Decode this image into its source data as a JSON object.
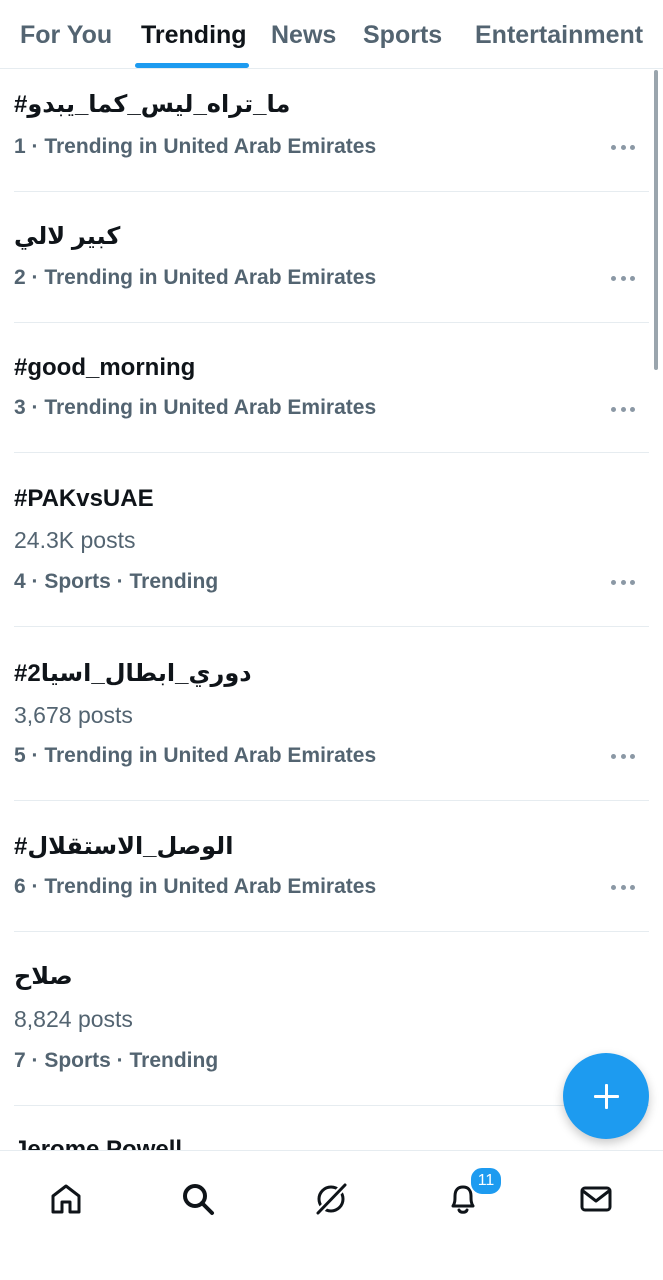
{
  "tabs": [
    "For You",
    "Trending",
    "News",
    "Sports",
    "Entertainment"
  ],
  "active_tab": "Trending",
  "trends": [
    {
      "title": "#ما_تراه_ليس_كما_يبدو",
      "posts": null,
      "meta": "1 · Trending in United Arab Emirates"
    },
    {
      "title": "كبير لالي",
      "posts": null,
      "meta": "2 · Trending in United Arab Emirates"
    },
    {
      "title": "#good_morning",
      "posts": null,
      "meta": "3 · Trending in United Arab Emirates"
    },
    {
      "title": "#PAKvsUAE",
      "posts": "24.3K posts",
      "meta": "4 · Sports · Trending"
    },
    {
      "title": "#دوري_ابطال_اسيا2",
      "posts": "3,678 posts",
      "meta": "5 · Trending in United Arab Emirates"
    },
    {
      "title": "#الوصل_الاستقلال",
      "posts": null,
      "meta": "6 · Trending in United Arab Emirates"
    },
    {
      "title": "صلاح",
      "posts": "8,824 posts",
      "meta": "7 · Sports · Trending"
    }
  ],
  "partial_trend_title": "Jerome Powell",
  "bottom_nav": {
    "items": [
      "home-icon",
      "search-icon",
      "grok-icon",
      "notifications-icon",
      "messages-icon"
    ],
    "notification_count": "11"
  },
  "colors": {
    "accent": "#1d9bf0",
    "primary_text": "#0f1419",
    "secondary_text": "#536471",
    "divider": "#e6ecf0"
  }
}
